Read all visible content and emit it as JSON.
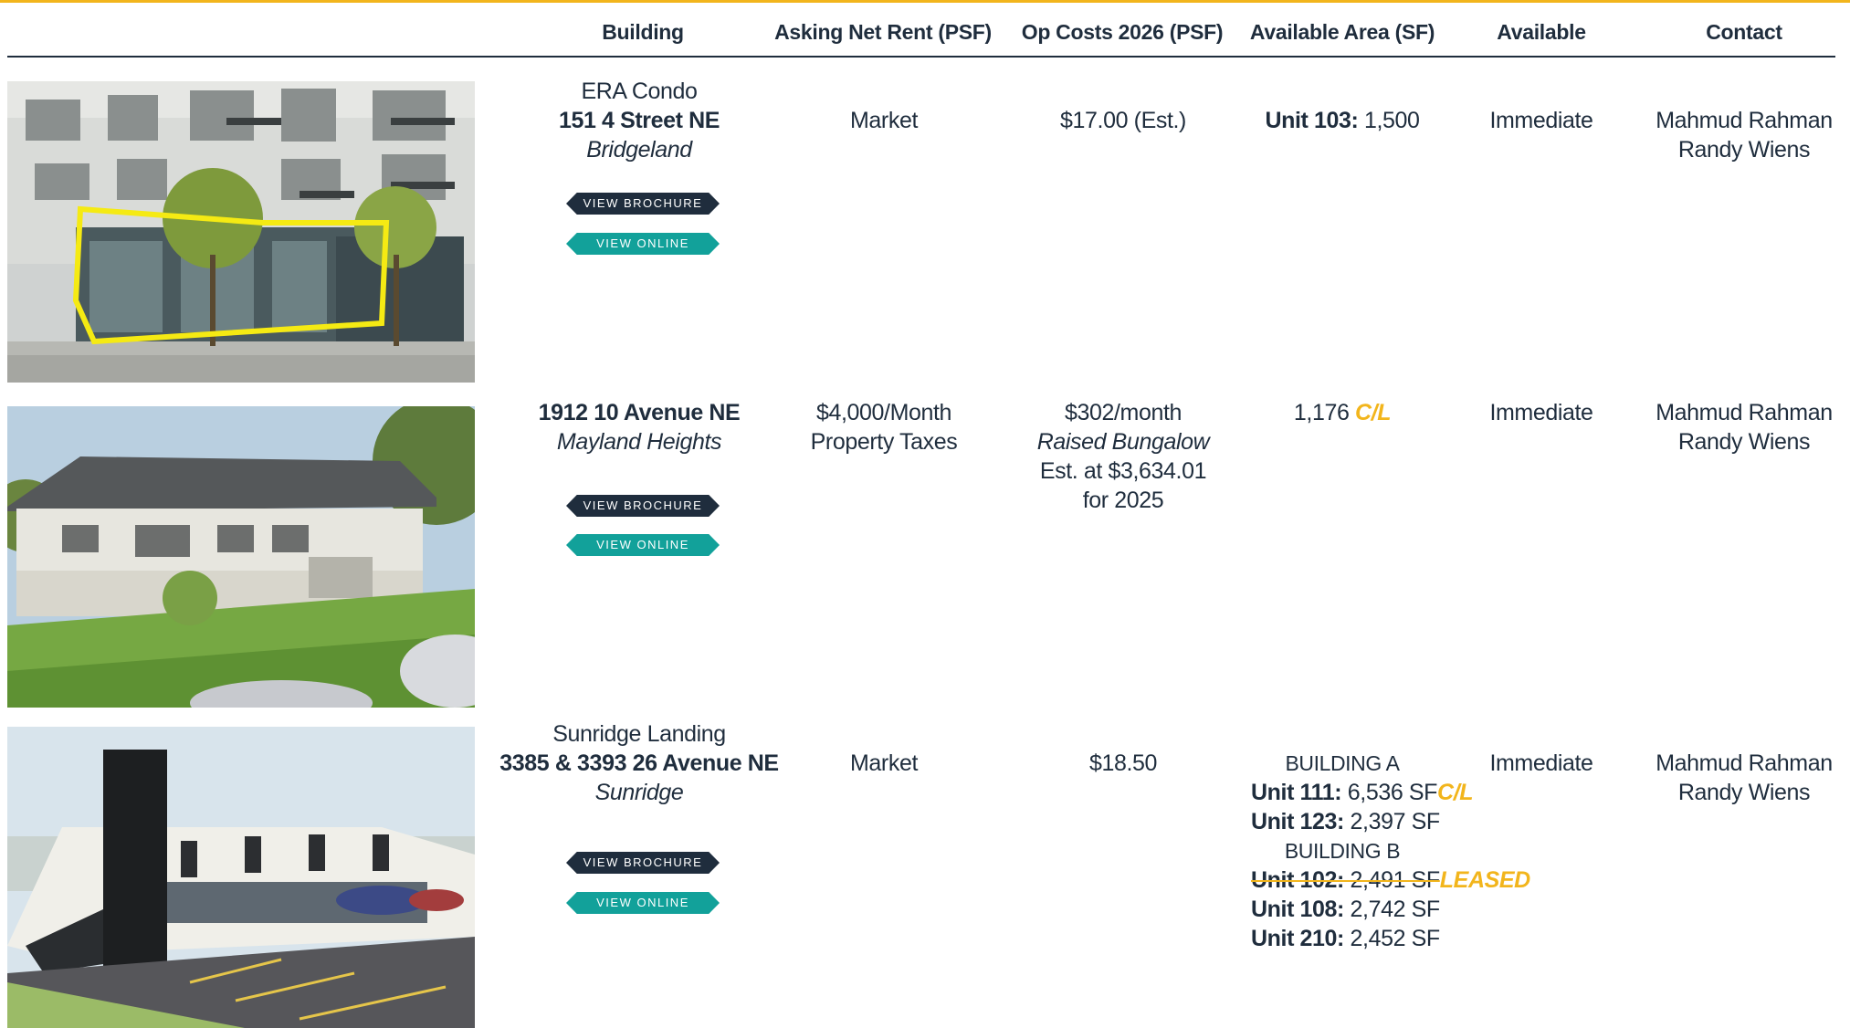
{
  "header": {
    "building": "Building",
    "asking_rent": "Asking Net Rent (PSF)",
    "op_costs": "Op Costs 2026 (PSF)",
    "available_area": "Available Area (SF)",
    "available": "Available",
    "contact": "Contact"
  },
  "buttons": {
    "brochure": "VIEW BROCHURE",
    "online": "VIEW ONLINE"
  },
  "listings": [
    {
      "name": "ERA Condo",
      "address": "151 4 Street NE",
      "area": "Bridgeland",
      "rent": "Market",
      "op_costs": "$17.00 (Est.)",
      "unit_label": "Unit 103:",
      "unit_value": " 1,500",
      "available": "Immediate",
      "contact_1": "Mahmud Rahman",
      "contact_2": "Randy Wiens"
    },
    {
      "address": "1912 10 Avenue NE",
      "area": "Mayland Heights",
      "rent_1": "$4,000/Month",
      "rent_2": "Property Taxes",
      "op_1": "$302/month",
      "op_2": "Raised Bungalow",
      "op_3": "Est. at $3,634.01",
      "op_4": "for 2025",
      "area_value": "1,176",
      "area_tag": "C/L",
      "available": "Immediate",
      "contact_1": "Mahmud Rahman",
      "contact_2": "Randy Wiens"
    },
    {
      "name": "Sunridge Landing",
      "address": "3385 & 3393 26 Avenue NE",
      "area": "Sunridge",
      "rent": "Market",
      "op_costs": "$18.50",
      "building_a": "BUILDING A",
      "u111_label": "Unit 111:",
      "u111_value": " 6,536 SF",
      "u111_tag": "C/L",
      "u123_label": "Unit 123:",
      "u123_value": " 2,397 SF",
      "building_b": "BUILDING B",
      "u102_label": "Unit 102:",
      "u102_value": " 2,491 SF",
      "u102_tag": "LEASED",
      "u108_label": "Unit 108:",
      "u108_value": " 2,742 SF",
      "u210_label": "Unit 210:",
      "u210_value": " 2,452 SF",
      "available": "Immediate",
      "contact_1": "Mahmud Rahman",
      "contact_2": "Randy Wiens"
    }
  ],
  "colors": {
    "accent": "#f2b51c",
    "navy": "#1f2d3d",
    "teal": "#12a19a"
  }
}
